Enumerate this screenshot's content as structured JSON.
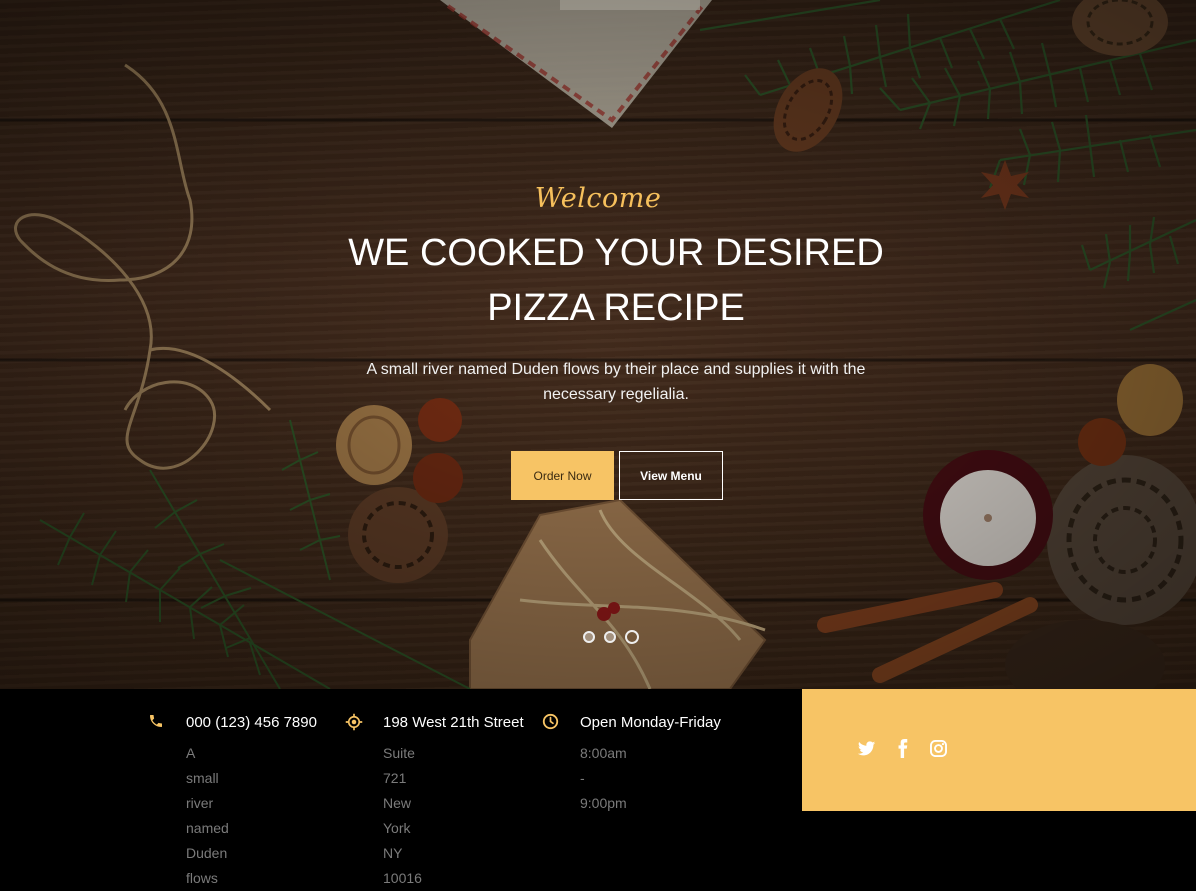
{
  "hero": {
    "welcome": "Welcome",
    "headline": "WE COOKED YOUR DESIRED PIZZA RECIPE",
    "subtext": "A small river named Duden flows by their place and supplies it with the necessary regelialia.",
    "order_label": "Order Now",
    "menu_label": "View Menu",
    "slides": [
      {
        "active": false
      },
      {
        "active": false
      },
      {
        "active": true
      }
    ]
  },
  "info": {
    "phone": {
      "icon": "phone-icon",
      "title": "000 (123) 456 7890",
      "detail": "A small river named\nDuden flows"
    },
    "address": {
      "icon": "location-icon",
      "title": "198 West 21th Street",
      "detail": "Suite 721 New York NY\n10016"
    },
    "hours": {
      "icon": "clock-icon",
      "title": "Open Monday-Friday",
      "detail": "8:00am - 9:00pm"
    }
  },
  "social": [
    "twitter-icon",
    "facebook-icon",
    "instagram-icon"
  ],
  "colors": {
    "accent": "#f7c465",
    "welcome": "#f6c05c",
    "info_bg": "#000000",
    "muted_text": "#7b7b7b"
  }
}
